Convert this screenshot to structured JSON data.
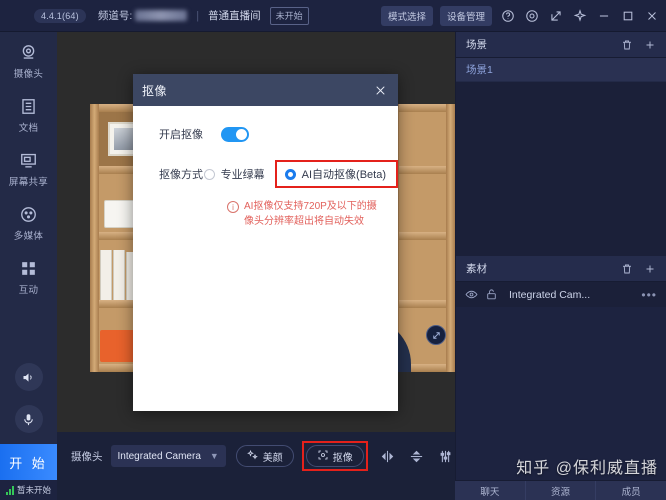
{
  "titlebar": {
    "version": "4.4.1(64)",
    "channel_label": "频道号:",
    "room_type": "普通直播间",
    "status": "未开始",
    "mode_button": "模式选择",
    "device_button": "设备管理",
    "icons": [
      "help-icon",
      "settings-icon",
      "share-icon",
      "pin-icon",
      "minimize-icon",
      "maximize-icon",
      "close-icon"
    ]
  },
  "sidebar": {
    "items": [
      {
        "label": "摄像头",
        "icon": "camera-icon"
      },
      {
        "label": "文档",
        "icon": "document-icon"
      },
      {
        "label": "屏幕共享",
        "icon": "screen-share-icon"
      },
      {
        "label": "多媒体",
        "icon": "multimedia-icon"
      },
      {
        "label": "互动",
        "icon": "interaction-icon"
      }
    ],
    "speaker_icon": "speaker-icon",
    "mic_icon": "microphone-icon",
    "start_button": "开 始",
    "status_text": "暂未开始"
  },
  "dialog": {
    "title": "抠像",
    "enable_label": "开启抠像",
    "enable_on": true,
    "mode_label": "抠像方式",
    "options": [
      {
        "text": "专业绿幕",
        "selected": false,
        "highlighted": false
      },
      {
        "text": "AI自动抠像(Beta)",
        "selected": true,
        "highlighted": true
      }
    ],
    "warning": "AI抠像仅支持720P及以下的摄像头分辨率超出将自动失效"
  },
  "scene_panel": {
    "title": "场景",
    "delete_icon": "trash-icon",
    "add_icon": "plus-icon",
    "items": [
      {
        "label": "场景1",
        "selected": true
      }
    ]
  },
  "material_panel": {
    "title": "素材",
    "delete_icon": "trash-icon",
    "add_icon": "plus-icon",
    "items": [
      {
        "name": "Integrated Cam...",
        "visible_icon": "eye-icon",
        "lock_icon": "unlock-icon",
        "menu": "•••"
      }
    ]
  },
  "bottom_toolbar": {
    "camera_label": "摄像头",
    "camera_value": "Integrated Camera",
    "chevron": "▼",
    "beauty_button": "美颜",
    "keying_button": "抠像",
    "keying_highlighted": true,
    "tools": [
      "flip-horizontal-icon",
      "flip-vertical-icon",
      "adjust-sliders-icon"
    ]
  },
  "right_tabs": [
    {
      "label": "聊天"
    },
    {
      "label": "资源"
    },
    {
      "label": "成员"
    }
  ],
  "watermark": "知乎 @保利威直播",
  "colors": {
    "accent_blue": "#1b7ced",
    "highlight_red": "#e4211b",
    "warning_red": "#e2615c",
    "panel_bg": "#1d2340",
    "titlebar_bg": "#1d2340"
  }
}
